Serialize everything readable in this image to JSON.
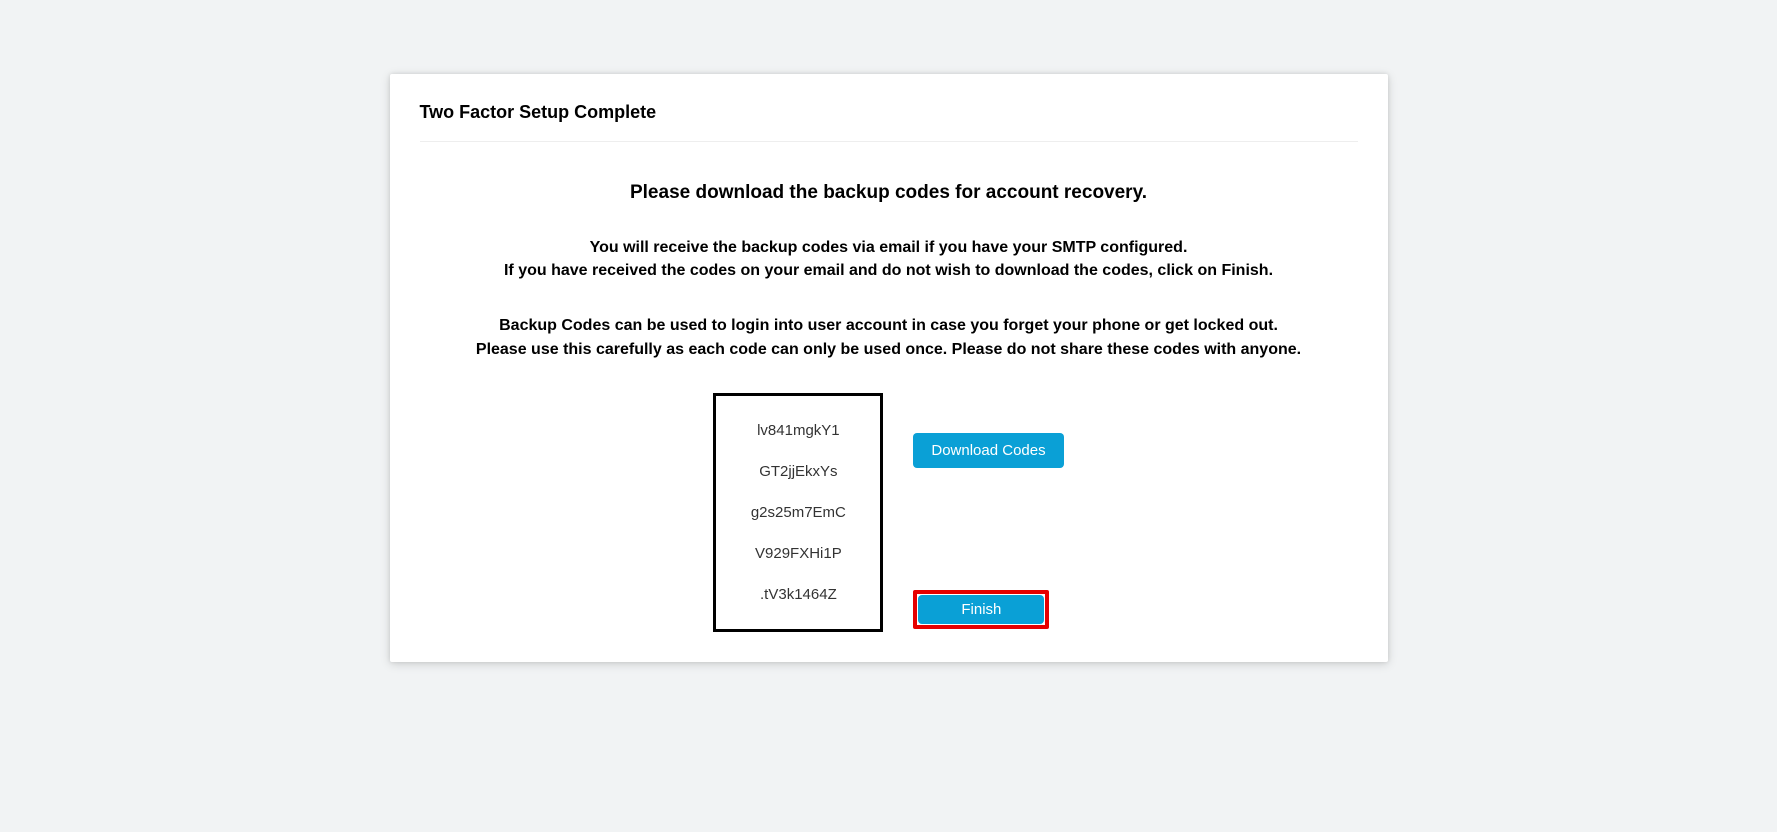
{
  "card": {
    "title": "Two Factor Setup Complete"
  },
  "instructions": {
    "heading": "Please download the backup codes for account recovery.",
    "line1": "You will receive the backup codes via email if you have your SMTP configured.",
    "line2": "If you have received the codes on your email and do not wish to download the codes, click on Finish.",
    "line3": "Backup Codes can be used to login into user account in case you forget your phone or get locked out.",
    "line4": "Please use this carefully as each code can only be used once. Please do not share these codes with anyone."
  },
  "codes": {
    "c1": "lv841mgkY1",
    "c2": "GT2jjEkxYs",
    "c3": "g2s25m7EmC",
    "c4": "V929FXHi1P",
    "c5": ".tV3k1464Z"
  },
  "buttons": {
    "download": "Download Codes",
    "finish": "Finish"
  }
}
